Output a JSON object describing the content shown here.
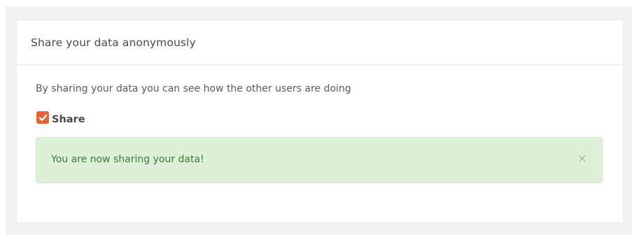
{
  "panel": {
    "title": "Share your data anonymously",
    "description": "By sharing your data you can see how the other users are doing",
    "share": {
      "label": "Share",
      "checked": true,
      "checkbox_color": "#e0643a"
    },
    "alert": {
      "message": "You are now sharing your data!",
      "close_symbol": "×",
      "background_color": "#dff0d8",
      "text_color": "#3c763d"
    }
  }
}
